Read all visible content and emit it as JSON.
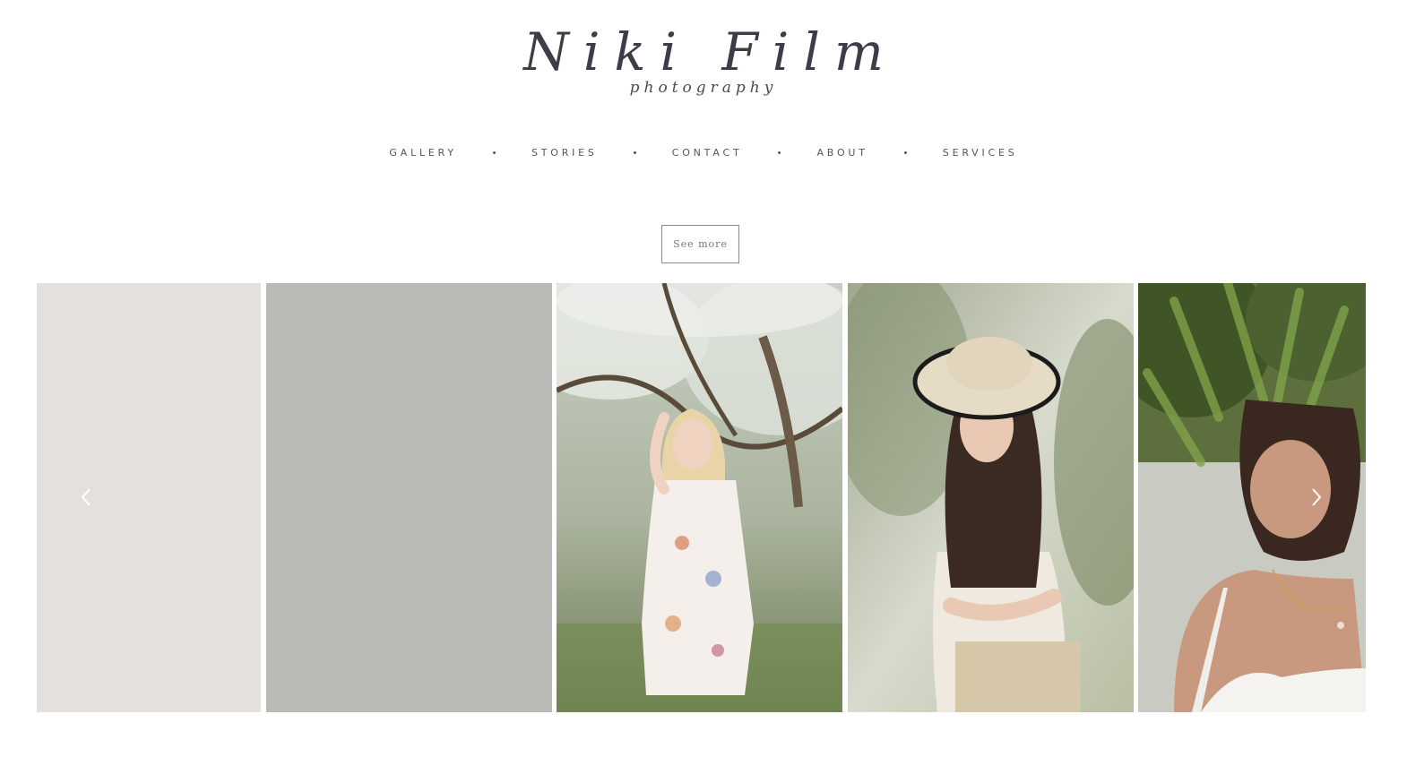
{
  "brand": {
    "title": "Niki Film",
    "subtitle": "photography"
  },
  "nav": {
    "items": [
      {
        "label": "GALLERY"
      },
      {
        "label": "STORIES"
      },
      {
        "label": "CONTACT"
      },
      {
        "label": "ABOUT"
      },
      {
        "label": "SERVICES"
      }
    ]
  },
  "cta": {
    "label": "See more"
  },
  "gallery": {
    "slides": [
      {
        "kind": "placeholder",
        "color": "#e3e0de"
      },
      {
        "kind": "placeholder",
        "color": "#babab6"
      },
      {
        "kind": "photo",
        "subject": "woman in floral dress under blossoming tree"
      },
      {
        "kind": "photo",
        "subject": "woman in straw hat and white blouse"
      },
      {
        "kind": "photo",
        "subject": "woman under green leaves with necklace"
      }
    ],
    "prev_icon": "chevron-left-icon",
    "next_icon": "chevron-right-icon"
  }
}
